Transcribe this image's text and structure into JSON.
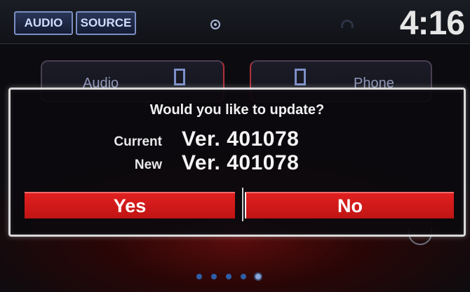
{
  "topbar": {
    "audio_label": "AUDIO",
    "source_label": "SOURCE",
    "clock": "4:16",
    "icons": [
      "navigation-icon",
      "wifi-icon"
    ]
  },
  "home_tiles": [
    {
      "label": "Audio",
      "icon": "audio-tile-icon"
    },
    {
      "label": "Phone",
      "icon": "phone-tile-icon"
    }
  ],
  "dialog": {
    "title": "Would you like to update?",
    "current_label": "Current",
    "current_version": "Ver. 401078",
    "new_label": "New",
    "new_version": "Ver. 401078",
    "yes_label": "Yes",
    "no_label": "No"
  },
  "pager": {
    "pages": 5,
    "active_index": 4
  },
  "colors": {
    "accent_red": "#d81a1a",
    "button_border_blue": "#7b8ec4"
  }
}
